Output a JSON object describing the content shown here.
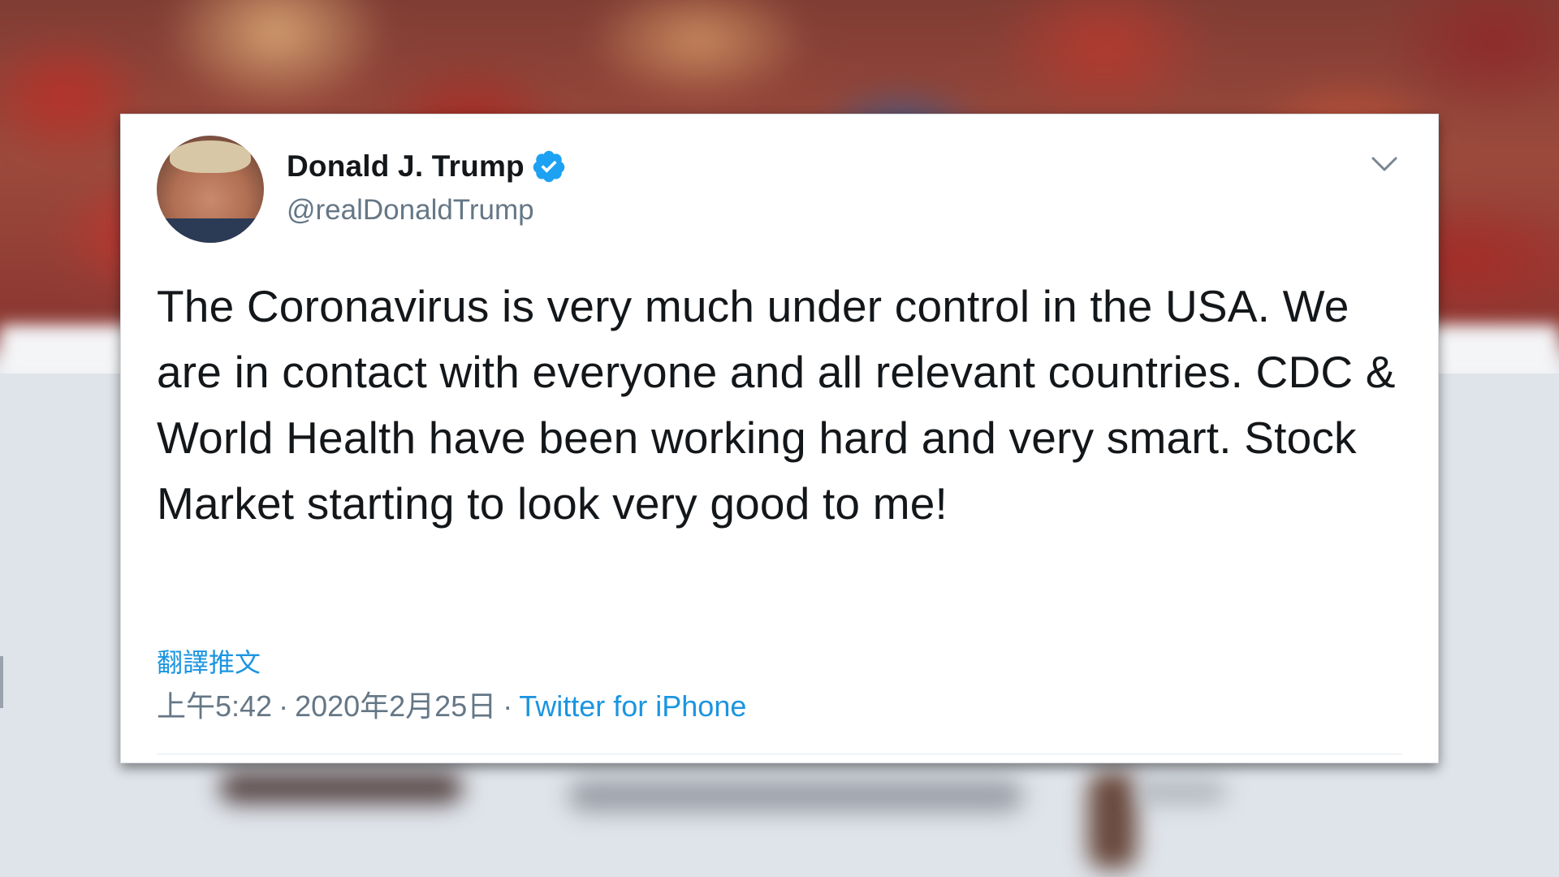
{
  "tweet": {
    "display_name": "Donald J. Trump",
    "handle": "@realDonaldTrump",
    "verified": true,
    "text": "The Coronavirus is very much under control in the USA. We are in contact with everyone and all relevant countries. CDC & World Health have been working hard and very smart. Stock Market starting to look very good to me!",
    "translate_label": "翻譯推文",
    "time": "上午5:42",
    "separator": "·",
    "date": "2020年2月25日",
    "source": "Twitter for iPhone"
  },
  "icons": {
    "verified": "verified-badge-icon",
    "menu": "chevron-down-icon"
  },
  "colors": {
    "link_blue": "#1b95e0",
    "verified_blue": "#1da1f2",
    "text_primary": "#14171a",
    "text_secondary": "#657786"
  }
}
